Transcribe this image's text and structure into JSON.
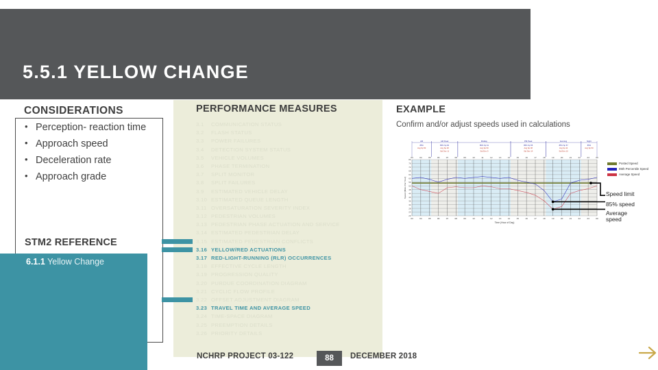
{
  "header": {
    "title": "5.5.1 YELLOW CHANGE"
  },
  "left": {
    "considerations_heading": "CONSIDERATIONS",
    "considerations": [
      "Perception- reaction time",
      "Approach speed",
      "Deceleration rate",
      "Approach grade"
    ],
    "stm2_heading": "STM2 REFERENCE",
    "stm2_ref_number": "6.1.1",
    "stm2_ref_title": "Yellow Change"
  },
  "performance": {
    "heading": "PERFORMANCE MEASURES",
    "items": [
      {
        "num": "3.1",
        "label": "COMMUNICATION STATUS",
        "state": "dim"
      },
      {
        "num": "3.2",
        "label": "FLASH STATUS",
        "state": "dim"
      },
      {
        "num": "3.3",
        "label": "POWER FAILURES",
        "state": "dim"
      },
      {
        "num": "3.4",
        "label": "DETECTION SYSTEM STATUS",
        "state": "dim"
      },
      {
        "num": "3.5",
        "label": "VEHICLE VOLUMES",
        "state": "dim"
      },
      {
        "num": "3.6",
        "label": "PHASE TERMINATION",
        "state": "dim"
      },
      {
        "num": "3.7",
        "label": "SPLIT MONITOR",
        "state": "dim"
      },
      {
        "num": "3.8",
        "label": "SPLIT FAILURES",
        "state": "dim"
      },
      {
        "num": "3.9",
        "label": "ESTIMATED VEHICLE DELAY",
        "state": "dim"
      },
      {
        "num": "3.10",
        "label": "ESTIMATED QUEUE LENGTH",
        "state": "dim"
      },
      {
        "num": "3.11",
        "label": "OVERSATURATION SEVERITY INDEX",
        "state": "dim"
      },
      {
        "num": "3.12",
        "label": "PEDESTRIAN VOLUMES",
        "state": "dim"
      },
      {
        "num": "3.13",
        "label": "PEDESTRIAN PHASE ACTUATION AND SERVICE",
        "state": "dim"
      },
      {
        "num": "3.14",
        "label": "ESTIMATED PEDESTRIAN DELAY",
        "state": "dim"
      },
      {
        "num": "3.15",
        "label": "ESTIMATED PEDESTRIAN CONFLICTS",
        "state": "dim"
      },
      {
        "num": "3.16",
        "label": "YELLOW/RED ACTUATIONS",
        "state": "highlight"
      },
      {
        "num": "3.17",
        "label": "RED-LIGHT-RUNNING (RLR) OCCURRENCES",
        "state": "highlight"
      },
      {
        "num": "3.18",
        "label": "EFFECTIVE CYCLE LENGTH",
        "state": "dim"
      },
      {
        "num": "3.19",
        "label": "PROGRESSION QUALITY",
        "state": "dim"
      },
      {
        "num": "3.20",
        "label": "PURDUE COORDINATION DIAGRAM",
        "state": "dim"
      },
      {
        "num": "3.21",
        "label": "CYCLIC FLOW PROFILE",
        "state": "dim"
      },
      {
        "num": "3.22",
        "label": "OFFSET ADJUSTMENT DIAGRAM",
        "state": "dim"
      },
      {
        "num": "3.23",
        "label": "TRAVEL TIME AND AVERAGE SPEED",
        "state": "highlight"
      },
      {
        "num": "3.24",
        "label": "TIME-SPACE DIAGRAM",
        "state": "dim"
      },
      {
        "num": "3.25",
        "label": "PREEMPTION DETAILS",
        "state": "dim"
      },
      {
        "num": "3.26",
        "label": "PRIORITY DETAILS",
        "state": "dim"
      }
    ],
    "marker_rows": [
      "3.15",
      "3.16",
      "3.22"
    ]
  },
  "example": {
    "heading": "EXAMPLE",
    "caption": "Confirm and/or adjust speeds used in calculations",
    "callouts": [
      {
        "text": "Speed limit"
      },
      {
        "text": "85% speed"
      },
      {
        "text": "Average speed"
      }
    ]
  },
  "footer": {
    "project": "NCHRP PROJECT 03-122",
    "page": "88",
    "date": "DECEMBER 2018",
    "next_icon": "arrow-right-icon"
  },
  "colors": {
    "header_gray": "#555759",
    "teal": "#3d93a4",
    "beige": "#ecedda",
    "dim_text": "#dcdecb",
    "arrow_gold": "#c9a849"
  },
  "chart_data": {
    "type": "line",
    "title": "",
    "xlabel": "Time (Hour of Day)",
    "ylabel": "Speed (Miles Per Hour)",
    "ylim": [
      20,
      80
    ],
    "yticks": [
      20,
      22,
      24,
      26,
      28,
      30,
      32,
      34,
      36,
      38,
      40,
      42,
      44,
      46,
      48,
      50,
      52,
      54,
      56,
      58,
      60,
      62,
      64,
      66,
      68,
      70,
      72,
      74,
      76,
      78,
      80
    ],
    "x": [
      "03",
      "04",
      "05",
      "06",
      "07",
      "08",
      "09",
      "10",
      "11",
      "12",
      "13",
      "14",
      "15",
      "16",
      "17",
      "18",
      "19",
      "20",
      "21",
      "22",
      "23",
      "00"
    ],
    "grid": true,
    "legend_position": "right",
    "series": [
      {
        "name": "Posted Speed",
        "color": "#6f7a2e",
        "values": [
          55,
          55,
          55,
          55,
          55,
          55,
          55,
          55,
          55,
          55,
          55,
          55,
          55,
          55,
          55,
          55,
          55,
          55,
          55,
          55,
          55,
          55
        ]
      },
      {
        "name": "85th Percentile Speed",
        "color": "#2222bb",
        "values": [
          60,
          61,
          59,
          56,
          59,
          61,
          60,
          61,
          62,
          61,
          60,
          61,
          58,
          56,
          54,
          47,
          35,
          38,
          55,
          58,
          59,
          61
        ]
      },
      {
        "name": "Average Speed",
        "color": "#cc3344",
        "values": [
          52,
          48,
          46,
          44,
          50,
          51,
          50,
          50,
          52,
          51,
          49,
          49,
          47,
          45,
          42,
          36,
          27,
          30,
          44,
          47,
          49,
          52
        ]
      }
    ],
    "band_annotations": [
      {
        "period": "AM",
        "stats": [
          "85%",
          "Avg Sp 50"
        ]
      },
      {
        "period": "AM Peak",
        "stats": [
          "85% Sp 60",
          "Avg Sp 48",
          "Std Dev 11"
        ]
      },
      {
        "period": "Midday",
        "stats": [
          "85% Sp 61",
          "Avg Sp 50",
          "Std Dev 9"
        ]
      },
      {
        "period": "PM Peak",
        "stats": [
          "85% Sp 55",
          "Avg Sp 38",
          "Std Dev 14"
        ]
      },
      {
        "period": "Evening",
        "stats": [
          "85% Sp 57",
          "Avg Sp 44",
          "Std Dev 10"
        ]
      },
      {
        "period": "Night",
        "stats": [
          "85%",
          "Avg Sp 50"
        ]
      }
    ]
  }
}
